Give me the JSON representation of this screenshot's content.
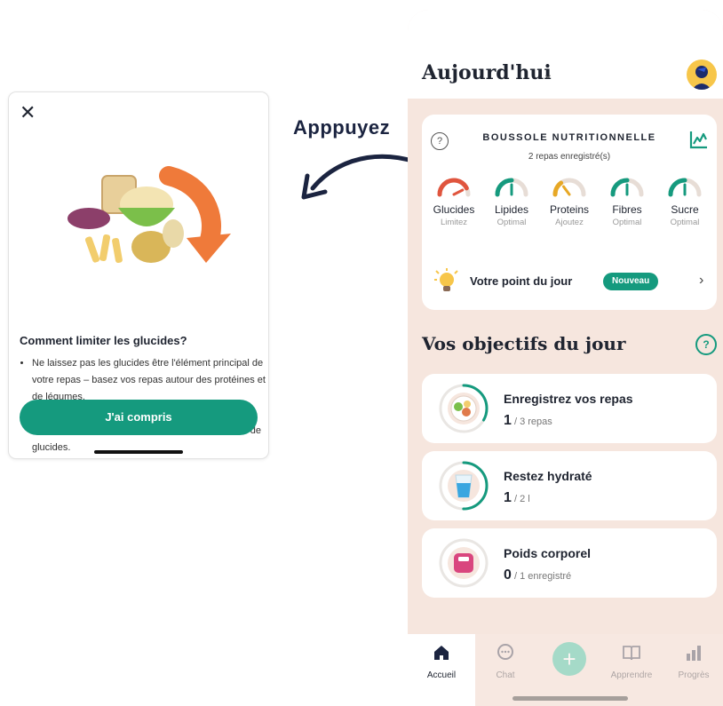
{
  "popup": {
    "title": "Comment limiter les glucides?",
    "bullets": [
      "Ne laissez pas les glucides être l'élément principal de votre repas – basez vos repas autour des protéines et de légumes.",
      "Souvenez-vous de suivre l'assiette équilibrée : seulement 1/4 de votre assiette doit être constitué de glucides."
    ],
    "cta": "J'ai compris",
    "close_icon": "close-icon"
  },
  "arrow_label": "Apppuyez",
  "app": {
    "header": {
      "title": "Aujourd'hui",
      "chevron": "⌄"
    },
    "compass": {
      "help": "?",
      "title": "BOUSSOLE NUTRITIONNELLE",
      "subtitle": "2 repas enregistré(s)",
      "gauges": [
        {
          "name": "Glucides",
          "status": "Limitez",
          "color": "#e0553e",
          "level": 0.85
        },
        {
          "name": "Lipides",
          "status": "Optimal",
          "color": "#159a7e",
          "level": 0.5
        },
        {
          "name": "Proteins",
          "status": "Ajoutez",
          "color": "#e7a825",
          "level": 0.3
        },
        {
          "name": "Fibres",
          "status": "Optimal",
          "color": "#159a7e",
          "level": 0.5
        },
        {
          "name": "Sucre",
          "status": "Optimal",
          "color": "#159a7e",
          "level": 0.5
        }
      ],
      "tip": {
        "label": "Votre point du jour",
        "badge": "Nouveau",
        "chevron": "›"
      }
    },
    "objectives": {
      "title": "Vos objectifs du jour",
      "help": "?",
      "goals": [
        {
          "title": "Enregistrez vos repas",
          "value": "1",
          "total": " / 3 repas",
          "progress": 0.333
        },
        {
          "title": "Restez hydraté",
          "value": "1",
          "total": " / 2 l",
          "progress": 0.5
        },
        {
          "title": "Poids corporel",
          "value": "0",
          "total": " / 1 enregistré",
          "progress": 0
        }
      ]
    },
    "tabs": [
      {
        "label": "Accueil",
        "icon": "home-icon"
      },
      {
        "label": "Chat",
        "icon": "chat-icon"
      },
      {
        "label": "",
        "icon": "plus-icon"
      },
      {
        "label": "Apprendre",
        "icon": "book-icon"
      },
      {
        "label": "Progrès",
        "icon": "progress-icon"
      }
    ],
    "colors": {
      "accent": "#159a7e",
      "background": "#f6e6de"
    }
  }
}
